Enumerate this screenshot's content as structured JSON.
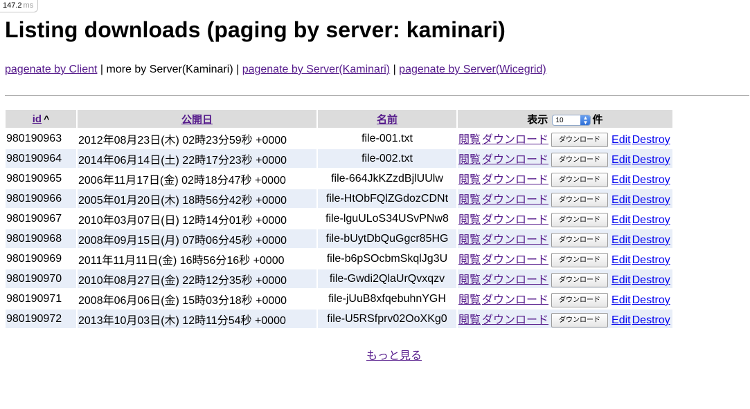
{
  "timing": {
    "value": "147.2",
    "unit": "ms"
  },
  "page_title": "Listing downloads (paging by server: kaminari)",
  "nav": {
    "link1": "pagenate by Client",
    "sep1": " | ",
    "current": "more by Server(Kaminari)",
    "sep2": " | ",
    "link2": "pagenate by Server(Kaminari)",
    "sep3": " | ",
    "link3": "pagenate by Server(Wicegrid)"
  },
  "table": {
    "headers": {
      "id": "id",
      "sort_indicator": "^",
      "date": "公開日",
      "name": "名前",
      "per_page_label": "表示",
      "per_page_value": "10",
      "per_page_suffix": "件"
    },
    "actions": {
      "view": "閲覧",
      "download_link": "ダウンロード",
      "download_button": "ダウンロード",
      "edit": "Edit",
      "destroy": "Destroy"
    },
    "rows": [
      {
        "id": "980190963",
        "date": "2012年08月23日(木) 02時23分59秒 +0000",
        "name": "file-001.txt"
      },
      {
        "id": "980190964",
        "date": "2014年06月14日(土) 22時17分23秒 +0000",
        "name": "file-002.txt"
      },
      {
        "id": "980190965",
        "date": "2006年11月17日(金) 02時18分47秒 +0000",
        "name": "file-664JkKZzdBjlUUlw"
      },
      {
        "id": "980190966",
        "date": "2005年01月20日(木) 18時56分42秒 +0000",
        "name": "file-HtObFQlZGdozCDNt"
      },
      {
        "id": "980190967",
        "date": "2010年03月07日(日) 12時14分01秒 +0000",
        "name": "file-lguULoS34USvPNw8"
      },
      {
        "id": "980190968",
        "date": "2008年09月15日(月) 07時06分45秒 +0000",
        "name": "file-bUytDbQuGgcr85HG"
      },
      {
        "id": "980190969",
        "date": "2011年11月11日(金) 16時56分16秒 +0000",
        "name": "file-b6pSOcbmSkqlJg3U"
      },
      {
        "id": "980190970",
        "date": "2010年08月27日(金) 22時12分35秒 +0000",
        "name": "file-Gwdi2QlaUrQvxqzv"
      },
      {
        "id": "980190971",
        "date": "2008年06月06日(金) 15時03分18秒 +0000",
        "name": "file-jUuB8xfqebuhnYGH"
      },
      {
        "id": "980190972",
        "date": "2013年10月03日(木) 12時11分54秒 +0000",
        "name": "file-U5RSfprv02OoXKg0"
      }
    ]
  },
  "more_link": "もっと見る"
}
